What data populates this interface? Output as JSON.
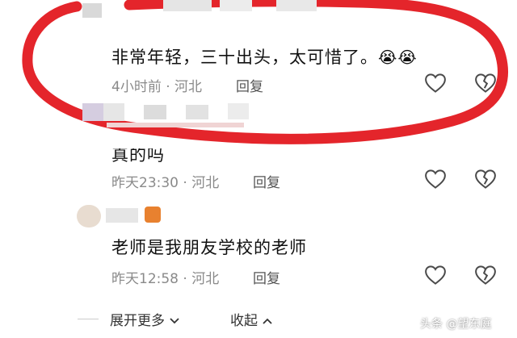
{
  "comments": [
    {
      "text": "非常年轻，三十出头，太可惜了。",
      "emoji": "😭😭",
      "time": "4小时前",
      "region": "河北",
      "reply_label": "回复"
    },
    {
      "text": "真的吗",
      "time": "昨天23:30",
      "region": "河北",
      "reply_label": "回复"
    },
    {
      "text": "老师是我朋友学校的老师",
      "time": "昨天12:58",
      "region": "河北",
      "reply_label": "回复"
    }
  ],
  "footer": {
    "expand_label": "展开更多",
    "collapse_label": "收起"
  },
  "watermark": "头条 @望东庭",
  "colors": {
    "annotation_red": "#e4252b",
    "meta_gray": "#8a8a8a"
  }
}
